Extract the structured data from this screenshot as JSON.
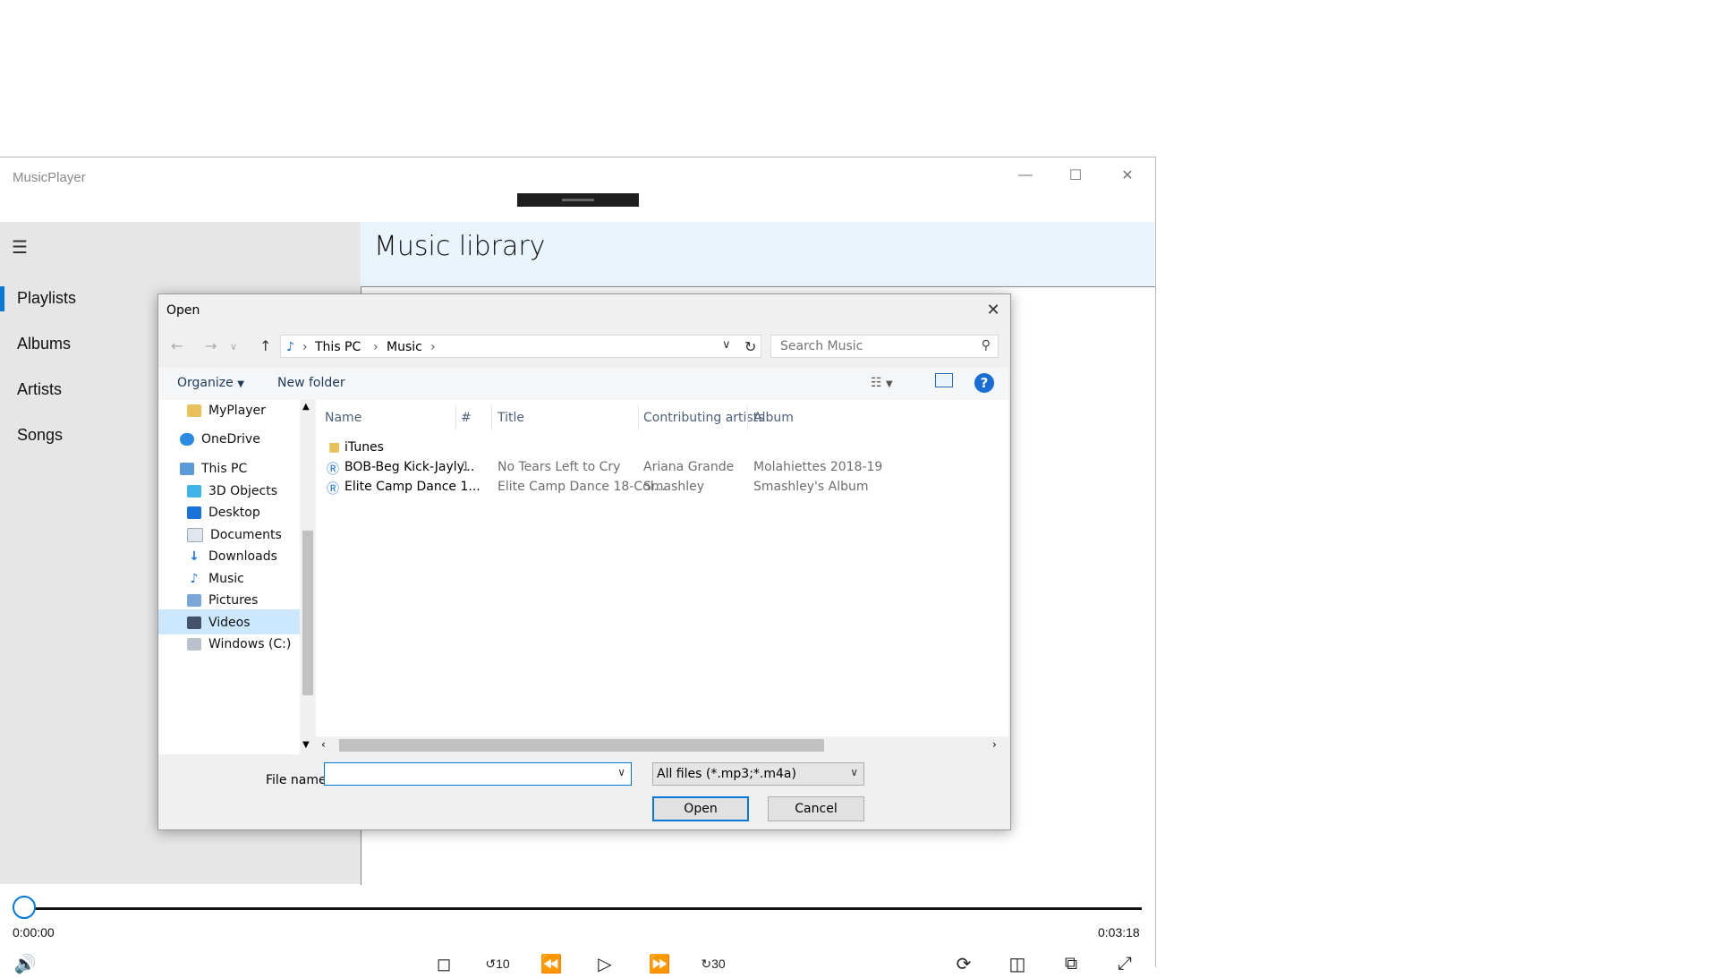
{
  "app": {
    "title": "MusicPlayer",
    "library_title": "Music library",
    "nav": [
      "Playlists",
      "Albums",
      "Artists",
      "Songs"
    ],
    "time_start": "0:00:00",
    "time_end": "0:03:18",
    "playback_progress": 0.0
  },
  "dialog": {
    "title": "Open",
    "breadcrumb": [
      "This PC",
      "Music"
    ],
    "search_placeholder": "Search Music",
    "toolbar": {
      "organize": "Organize",
      "new_folder": "New folder"
    },
    "tree": [
      "MyPlayer",
      "OneDrive",
      "This PC",
      "3D Objects",
      "Desktop",
      "Documents",
      "Downloads",
      "Music",
      "Pictures",
      "Videos",
      "Windows (C:)"
    ],
    "selected_tree_item": "Music",
    "columns": [
      "Name",
      "#",
      "Title",
      "Contributing artists",
      "Album"
    ],
    "rows": [
      {
        "name": "iTunes",
        "number": "",
        "title": "",
        "artists": "",
        "album": ""
      },
      {
        "name": "BOB-Beg Kick-Jayly...",
        "number": "1",
        "title": "No Tears Left to Cry",
        "artists": "Ariana Grande",
        "album": "Molahiettes 2018-19"
      },
      {
        "name": "Elite Camp Dance 1...",
        "number": "",
        "title": "Elite Camp Dance 18-Col...",
        "artists": "Smashley",
        "album": "Smashley's Album"
      }
    ],
    "file_name_label": "File name:",
    "file_name_value": "",
    "filter": "All files (*.mp3;*.m4a)",
    "open_button": "Open",
    "cancel_button": "Cancel"
  }
}
